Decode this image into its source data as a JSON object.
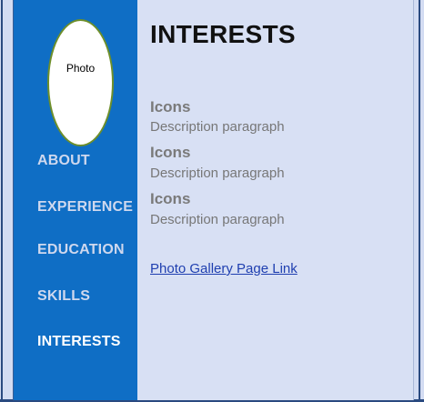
{
  "sidebar": {
    "photo_label": "Photo",
    "nav": [
      {
        "label": "ABOUT",
        "active": false
      },
      {
        "label": "EXPERIENCE",
        "active": false
      },
      {
        "label": "EDUCATION",
        "active": false
      },
      {
        "label": "SKILLS",
        "active": false
      },
      {
        "label": "INTERESTS",
        "active": true
      }
    ]
  },
  "main": {
    "title": "INTERESTS",
    "items": [
      {
        "title": "Icons",
        "description": "Description paragraph"
      },
      {
        "title": "Icons",
        "description": "Description paragraph"
      },
      {
        "title": "Icons",
        "description": "Description paragraph"
      }
    ],
    "gallery_link": "Photo Gallery Page Link"
  },
  "colors": {
    "sidebar_bg": "#0f6ec5",
    "main_bg": "#d8e0f4",
    "nav_text": "#cfd8ee",
    "nav_active": "#ffffff",
    "link": "#1f3fb0"
  }
}
